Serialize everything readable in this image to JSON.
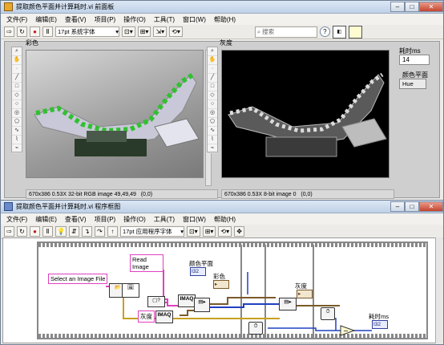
{
  "front_panel": {
    "title": "提取颜色平面并计算耗时.vi 前面板",
    "menu": [
      "文件(F)",
      "编辑(E)",
      "查看(V)",
      "项目(P)",
      "操作(O)",
      "工具(T)",
      "窗口(W)",
      "帮助(H)"
    ],
    "font_select": "17pt 系统字体",
    "search_placeholder": "搜索",
    "color_image": {
      "label": "彩色",
      "status_size": "670x386 0.53X 32-bit RGB image 49,49,49",
      "status_coord": "(0,0)"
    },
    "gray_image": {
      "label": "灰度",
      "status_size": "670x386 0.53X 8-bit image 0",
      "status_coord": "(0,0)"
    },
    "elapsed": {
      "label": "耗时ms",
      "value": "14"
    },
    "color_plane": {
      "label": "颜色平面",
      "value": "Hue"
    }
  },
  "block_diagram": {
    "title": "提取颜色平面并计算耗时.vi 程序框图",
    "menu": [
      "文件(F)",
      "编辑(E)",
      "查看(V)",
      "项目(P)",
      "操作(O)",
      "工具(T)",
      "窗口(W)",
      "帮助(H)"
    ],
    "font_select": "17pt 应用程序字体",
    "nodes": {
      "read_image": "Read\nImage",
      "select_file": "Select an Image File",
      "color_plane_label": "颜色平面",
      "color_plane_term": "I32",
      "color_label": "彩色",
      "gray_label": "灰度",
      "gray_label2": "灰度",
      "imaq1": "IMAQ",
      "imaq2": "IMAQ",
      "elapsed_label": "耗时ms"
    }
  },
  "colors": {
    "titlebar": "#c9d8ec",
    "pink_wire": "#e040c0",
    "image_wire": "#7a5a2a",
    "blue_wire": "#2040c0"
  }
}
